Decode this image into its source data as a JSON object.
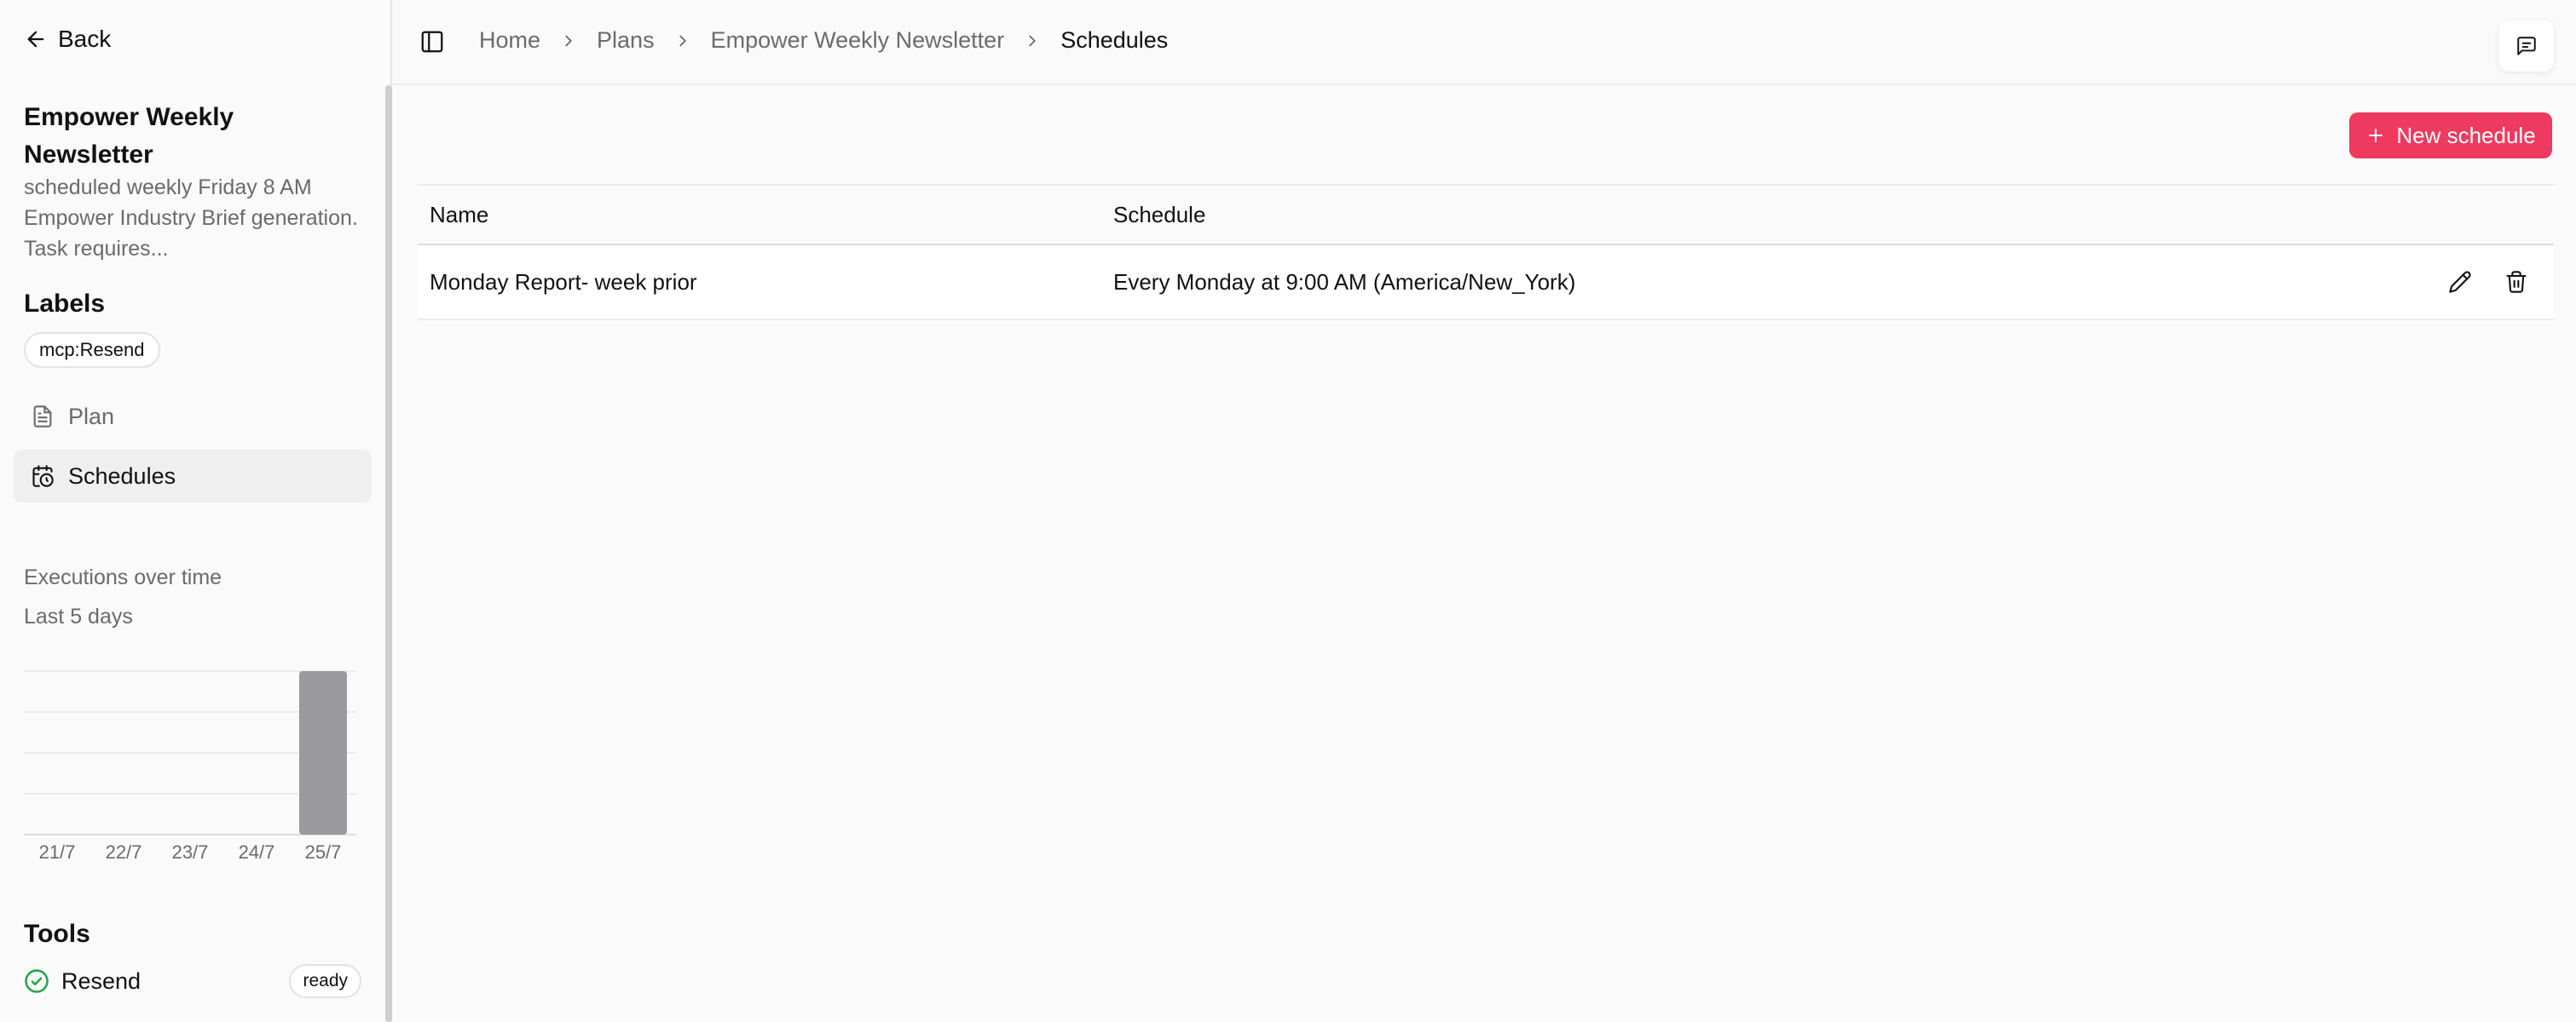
{
  "sidebar": {
    "back_label": "Back",
    "plan_title": "Empower Weekly Newsletter",
    "plan_description": "scheduled weekly Friday 8 AM Empower Industry Brief generation. Task requires...",
    "labels_heading": "Labels",
    "labels": [
      "mcp:Resend"
    ],
    "nav": [
      {
        "label": "Plan",
        "icon": "document-icon",
        "active": false
      },
      {
        "label": "Schedules",
        "icon": "calendar-clock-icon",
        "active": true
      }
    ],
    "executions": {
      "title": "Executions over time",
      "subtitle": "Last 5 days"
    },
    "tools_heading": "Tools",
    "tools": [
      {
        "name": "Resend",
        "status": "ready",
        "icon": "check-circle-icon"
      }
    ]
  },
  "chart_data": {
    "type": "bar",
    "categories": [
      "21/7",
      "22/7",
      "23/7",
      "24/7",
      "25/7"
    ],
    "values": [
      0,
      0,
      0,
      0,
      1
    ],
    "ylim": [
      0,
      1
    ],
    "grid": true,
    "bar_color": "#9b9b9f"
  },
  "header": {
    "breadcrumb": [
      "Home",
      "Plans",
      "Empower Weekly Newsletter",
      "Schedules"
    ],
    "feedback_icon": "message-square-icon"
  },
  "main": {
    "new_schedule_label": "New schedule",
    "table": {
      "columns": [
        "Name",
        "Schedule"
      ],
      "rows": [
        {
          "name": "Monday Report- week prior",
          "schedule": "Every Monday at 9:00 AM (America/New_York)"
        }
      ]
    }
  },
  "colors": {
    "accent": "#ee3a5e",
    "success": "#22a447",
    "muted_text": "#6b6b6b"
  }
}
